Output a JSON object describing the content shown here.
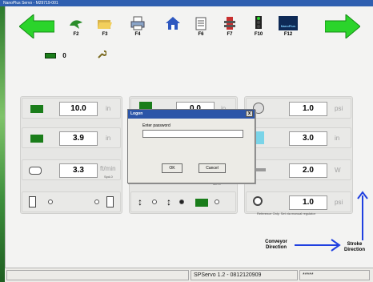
{
  "window": {
    "title": "NanoPlus Servo - M29719-001"
  },
  "toolbar": {
    "buttons": [
      {
        "key": "F2",
        "icon": "bird-icon"
      },
      {
        "key": "F3",
        "icon": "folder-open-icon"
      },
      {
        "key": "F4",
        "icon": "printer-icon"
      },
      {
        "key": "",
        "icon": "home-icon"
      },
      {
        "key": "F6",
        "icon": "notepad-icon"
      },
      {
        "key": "F7",
        "icon": "servo-icon"
      },
      {
        "key": "F10",
        "icon": "traffic-light-icon"
      },
      {
        "key": "F12",
        "icon": "nanoplus-logo-icon"
      }
    ],
    "logo_text": "NanoPlus"
  },
  "status": {
    "count": "0"
  },
  "fields": {
    "left": [
      {
        "value": "10.0",
        "unit": "in"
      },
      {
        "value": "3.9",
        "unit": "in"
      },
      {
        "value": "3.3",
        "unit": "ft/min",
        "sub": "Spd-0"
      }
    ],
    "middle": [
      {
        "value": "0.0",
        "unit": "in"
      },
      {
        "sub": "Min.0"
      }
    ],
    "right": [
      {
        "value": "1.0",
        "unit": "psi"
      },
      {
        "value": "3.0",
        "unit": "in"
      },
      {
        "value": "2.0",
        "unit": "W"
      },
      {
        "value": "1.0",
        "unit": "psi"
      }
    ],
    "right_note": "Reference Only. Set via manual regulator"
  },
  "dialog": {
    "title": "Logon",
    "label": "Enter password",
    "ok": "OK",
    "cancel": "Cancel",
    "close": "x"
  },
  "captions": {
    "conveyor": "Conveyor Direction",
    "stroke": "Stroke Direction"
  },
  "statusbar": {
    "version": "SPServo 1.2 - 0812120909",
    "password_mask": "*****"
  },
  "colors": {
    "accent_green": "#2bd42b",
    "title_blue": "#2f5fb0",
    "arrow_blue": "#1f3fe0"
  }
}
